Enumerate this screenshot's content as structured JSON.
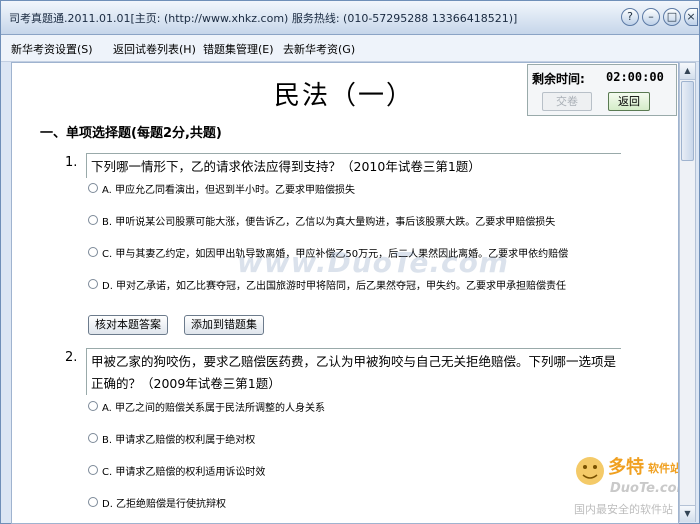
{
  "titlebar": {
    "title": "司考真题通.2011.01.01[主页: (http://www.xhkz.com) 服务热线: (010-57295288 13366418521)]",
    "controls": [
      "?",
      "–",
      "□",
      "×"
    ]
  },
  "menu": [
    "新华考资设置(S)",
    "返回试卷列表(H)",
    "错题集管理(E)",
    "去新华考资(G)"
  ],
  "exam": {
    "title": "民法（一）"
  },
  "timer": {
    "label": "剩余时间:",
    "value": "02:00:00",
    "submit_label": "交卷",
    "back_label": "返回"
  },
  "section": {
    "heading": "一、单项选择题(每题2分,共题)"
  },
  "questions": [
    {
      "number": "1.",
      "text": "下列哪一情形下，乙的请求依法应得到支持？（2010年试卷三第1题）",
      "options": [
        "A. 甲应允乙同看演出，但迟到半小时。乙要求甲赔偿损失",
        "B. 甲听说某公司股票可能大涨，便告诉乙，乙信以为真大量购进，事后该股票大跌。乙要求甲赔偿损失",
        "C. 甲与其妻乙约定，如因甲出轨导致离婚，甲应补偿乙50万元，后二人果然因此离婚。乙要求甲依约赔偿",
        "D. 甲对乙承诺，如乙比赛夺冠，乙出国旅游时甲将陪同，后乙果然夺冠，甲失约。乙要求甲承担赔偿责任"
      ],
      "check_label": "核对本题答案",
      "add_label": "添加到错题集"
    },
    {
      "number": "2.",
      "text": "甲被乙家的狗咬伤，要求乙赔偿医药费，乙认为甲被狗咬与自己无关拒绝赔偿。下列哪一选项是正确的？（2009年试卷三第1题）",
      "options": [
        "A. 甲乙之间的赔偿关系属于民法所调整的人身关系",
        "B. 甲请求乙赔偿的权利属于绝对权",
        "C. 甲请求乙赔偿的权利适用诉讼时效",
        "D. 乙拒绝赔偿是行使抗辩权"
      ]
    }
  ],
  "watermark": "www.DuoTe.com",
  "logo": {
    "name": "多特",
    "tag": "软件站",
    "url": "DuoTe.com",
    "slogan": "国内最安全的软件站"
  },
  "icons": {
    "scroll_up": "▲",
    "scroll_down": "▼"
  }
}
